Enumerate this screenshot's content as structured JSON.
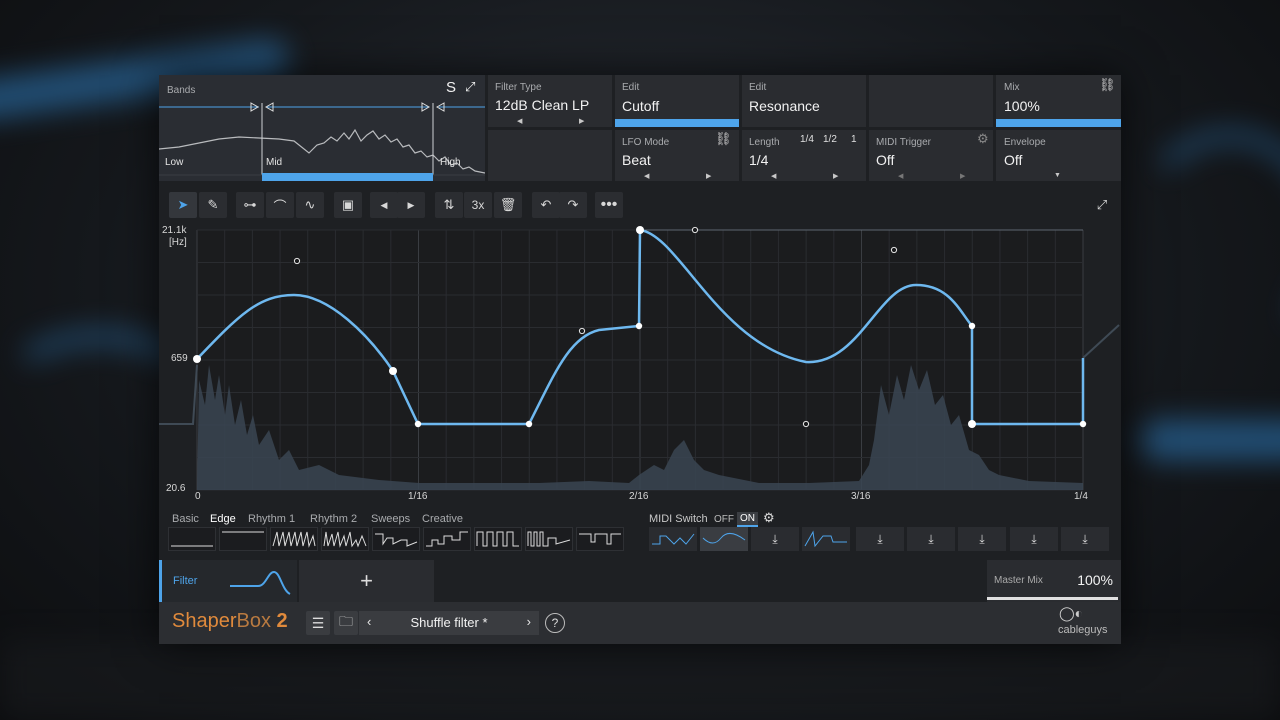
{
  "bands": {
    "title": "Bands",
    "solo": "S",
    "low": "Low",
    "mid": "Mid",
    "high": "High"
  },
  "filter_type": {
    "label": "Filter Type",
    "value": "12dB Clean LP"
  },
  "edit1": {
    "label": "Edit",
    "value": "Cutoff"
  },
  "edit2": {
    "label": "Edit",
    "value": "Resonance"
  },
  "mix": {
    "label": "Mix",
    "value": "100%",
    "level": 1.0
  },
  "lfo_mode": {
    "label": "LFO Mode",
    "value": "Beat"
  },
  "length": {
    "label": "Length",
    "value": "1/4",
    "options": [
      "1/4",
      "1/2",
      "1"
    ]
  },
  "midi_trigger": {
    "label": "MIDI Trigger",
    "value": "Off"
  },
  "envelope": {
    "label": "Envelope",
    "value": "Off"
  },
  "toolbar": {
    "multiplier": "3x"
  },
  "graph": {
    "y_top": "21.1k",
    "y_unit": "[Hz]",
    "y_mid": "659",
    "y_bottom": "20.6",
    "x_labels": [
      "0",
      "1/16",
      "2/16",
      "3/16",
      "1/4"
    ]
  },
  "preset_tabs": [
    "Basic",
    "Edge",
    "Rhythm 1",
    "Rhythm 2",
    "Sweeps",
    "Creative"
  ],
  "selected_tab": "Edge",
  "midi_switch": {
    "label": "MIDI Switch",
    "off": "OFF",
    "on": "ON"
  },
  "footer": {
    "filter_tab": "Filter",
    "add": "+",
    "master_mix_label": "Master Mix",
    "master_mix_value": "100%",
    "master_mix_level": 1.0
  },
  "bottom": {
    "brand_main": "Shaper",
    "brand_box": "Box",
    "brand_ver": "2",
    "preset_name": "Shuffle filter *",
    "company": "cableguys",
    "help": "?"
  },
  "colors": {
    "accent": "#4ea4ea",
    "brand": "#e08a3c"
  }
}
